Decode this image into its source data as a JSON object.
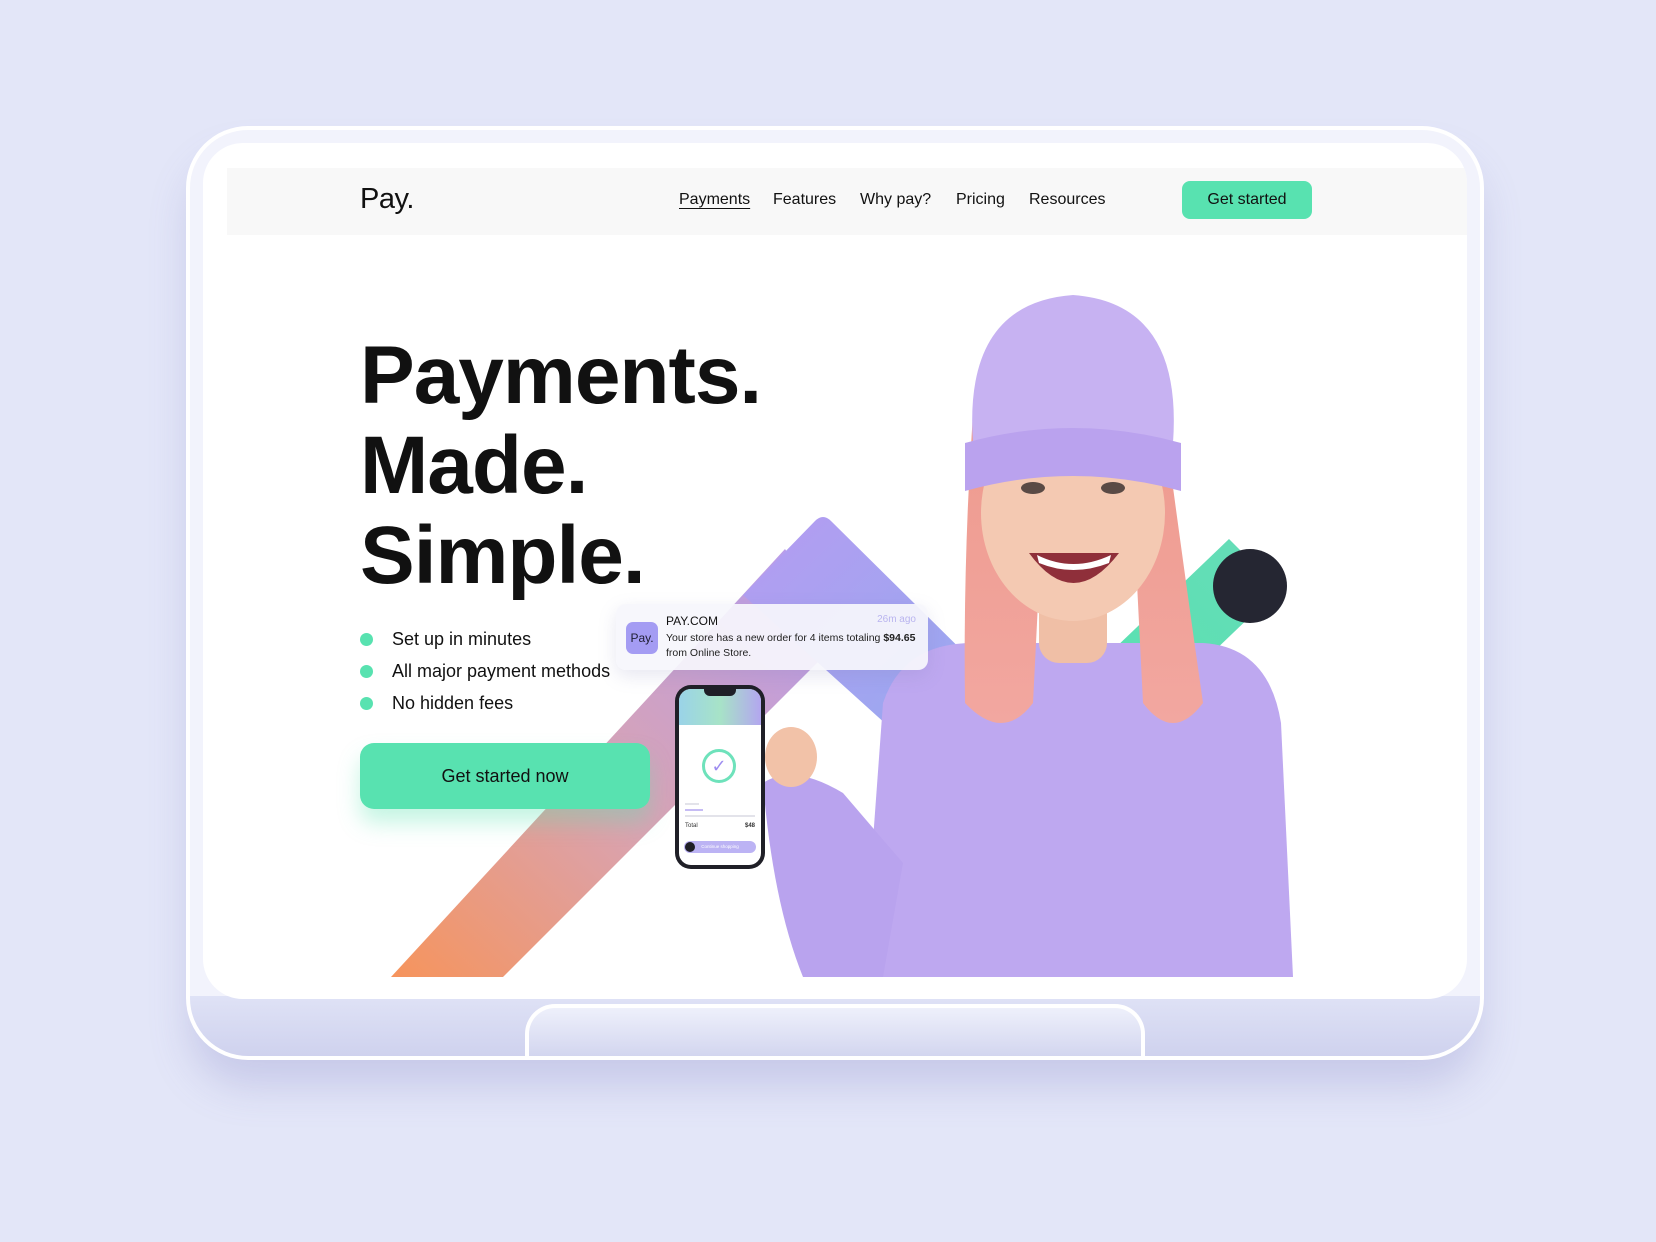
{
  "brand": {
    "logo": "Pay."
  },
  "nav": {
    "items": [
      {
        "label": "Payments",
        "active": true
      },
      {
        "label": "Features"
      },
      {
        "label": "Why pay?"
      },
      {
        "label": "Pricing"
      },
      {
        "label": "Resources"
      }
    ],
    "cta_label": "Get started"
  },
  "hero": {
    "headline": [
      "Payments.",
      "Made.",
      "Simple."
    ],
    "features": [
      "Set up in minutes",
      "All major payment methods",
      "No hidden fees"
    ],
    "cta_label": "Get started now"
  },
  "notification": {
    "logo": "Pay.",
    "title": "PAY.COM",
    "time": "26m ago",
    "body_prefix": "Your store has a new order for 4 items totaling ",
    "amount": "$94.65",
    "body_suffix": " from Online Store."
  },
  "phone": {
    "total_label": "Total",
    "total_value": "$48",
    "button_label": "Continue shopping"
  },
  "colors": {
    "accent": "#58e2b0",
    "purple": "#a49cf3",
    "background": "#e3e6f8",
    "text": "#111111",
    "dark": "#252632"
  }
}
